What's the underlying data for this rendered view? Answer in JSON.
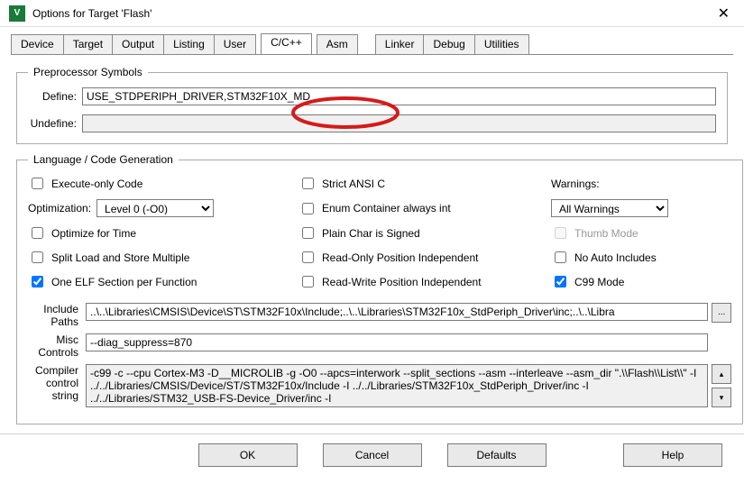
{
  "window": {
    "title": "Options for Target 'Flash'"
  },
  "tabs": [
    {
      "label": "Device",
      "active": false
    },
    {
      "label": "Target",
      "active": false
    },
    {
      "label": "Output",
      "active": false
    },
    {
      "label": "Listing",
      "active": false
    },
    {
      "label": "User",
      "active": false
    },
    {
      "label": "C/C++",
      "active": true
    },
    {
      "label": "Asm",
      "active": false
    },
    {
      "label": "Linker",
      "active": false
    },
    {
      "label": "Debug",
      "active": false
    },
    {
      "label": "Utilities",
      "active": false
    }
  ],
  "preproc": {
    "legend": "Preprocessor Symbols",
    "define_label": "Define:",
    "define_value": "USE_STDPERIPH_DRIVER,STM32F10X_MD",
    "undefine_label": "Undefine:",
    "undefine_value": ""
  },
  "lang": {
    "legend": "Language / Code Generation",
    "execute_only": "Execute-only Code",
    "optimization_label": "Optimization:",
    "optimization_value": "Level 0 (-O0)",
    "optimize_time": "Optimize for Time",
    "split_load": "Split Load and Store Multiple",
    "one_elf": "One ELF Section per Function",
    "strict_ansi": "Strict ANSI C",
    "enum_container": "Enum Container always int",
    "plain_char": "Plain Char is Signed",
    "ro_pos": "Read-Only Position Independent",
    "rw_pos": "Read-Write Position Independent",
    "warnings_label": "Warnings:",
    "warnings_value": "All Warnings",
    "thumb_mode": "Thumb Mode",
    "no_auto": "No Auto Includes",
    "c99": "C99 Mode"
  },
  "paths": {
    "include_label": "Include\nPaths",
    "include_value": "..\\..\\Libraries\\CMSIS\\Device\\ST\\STM32F10x\\Include;..\\..\\Libraries\\STM32F10x_StdPeriph_Driver\\inc;..\\..\\Libra",
    "misc_label": "Misc\nControls",
    "misc_value": "--diag_suppress=870",
    "compiler_label": "Compiler\ncontrol\nstring",
    "compiler_value": "-c99 -c --cpu Cortex-M3 -D__MICROLIB -g -O0 --apcs=interwork --split_sections --asm --interleave --asm_dir \".\\\\Flash\\\\List\\\\\" -I ../../Libraries/CMSIS/Device/ST/STM32F10x/Include -I ../../Libraries/STM32F10x_StdPeriph_Driver/inc -I ../../Libraries/STM32_USB-FS-Device_Driver/inc -I"
  },
  "buttons": {
    "ok": "OK",
    "cancel": "Cancel",
    "defaults": "Defaults",
    "help": "Help"
  }
}
